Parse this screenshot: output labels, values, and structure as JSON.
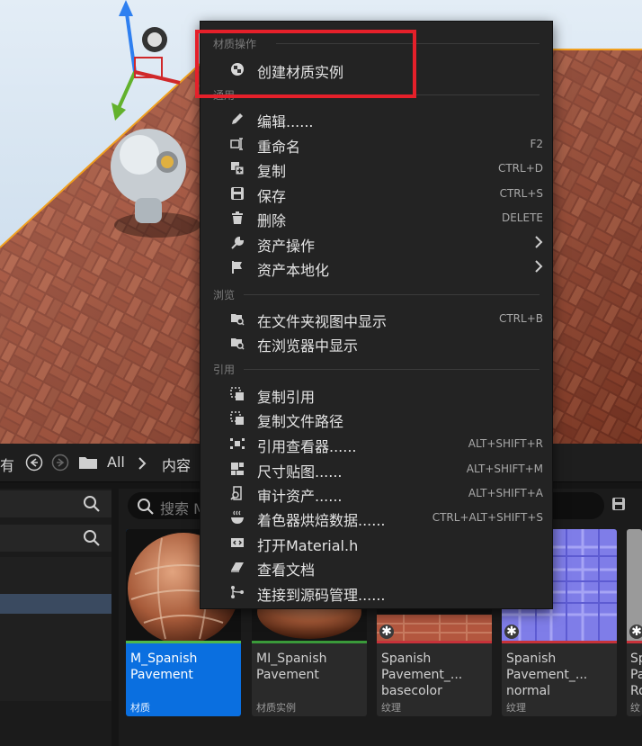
{
  "menu": {
    "section_material": "材质操作",
    "create_instance": "创建材质实例",
    "section_common": "通用",
    "items_common": [
      {
        "label": "编辑......",
        "shortcut": "",
        "icon": "pencil-icon"
      },
      {
        "label": "重命名",
        "shortcut": "F2",
        "icon": "rename-icon"
      },
      {
        "label": "复制",
        "shortcut": "CTRL+D",
        "icon": "duplicate-icon"
      },
      {
        "label": "保存",
        "shortcut": "CTRL+S",
        "icon": "save-icon"
      },
      {
        "label": "删除",
        "shortcut": "DELETE",
        "icon": "trash-icon"
      },
      {
        "label": "资产操作",
        "shortcut": "",
        "icon": "wrench-icon",
        "submenu": true
      },
      {
        "label": "资产本地化",
        "shortcut": "",
        "icon": "flag-icon",
        "submenu": true
      }
    ],
    "section_browse": "浏览",
    "items_browse": [
      {
        "label": "在文件夹视图中显示",
        "shortcut": "CTRL+B",
        "icon": "folder-search-icon"
      },
      {
        "label": "在浏览器中显示",
        "shortcut": "",
        "icon": "folder-search-icon"
      }
    ],
    "section_reference": "引用",
    "items_reference": [
      {
        "label": "复制引用",
        "shortcut": "",
        "icon": "copy-reference-icon"
      },
      {
        "label": "复制文件路径",
        "shortcut": "",
        "icon": "copy-path-icon"
      },
      {
        "label": "引用查看器......",
        "shortcut": "ALT+SHIFT+R",
        "icon": "reference-viewer-icon"
      },
      {
        "label": "尺寸贴图......",
        "shortcut": "ALT+SHIFT+M",
        "icon": "size-map-icon"
      },
      {
        "label": "审计资产......",
        "shortcut": "ALT+SHIFT+A",
        "icon": "audit-icon"
      },
      {
        "label": "着色器烘焙数据......",
        "shortcut": "CTRL+ALT+SHIFT+S",
        "icon": "shader-icon"
      },
      {
        "label": "打开Material.h",
        "shortcut": "",
        "icon": "code-file-icon"
      },
      {
        "label": "查看文档",
        "shortcut": "",
        "icon": "docs-icon"
      },
      {
        "label": "连接到源码管理......",
        "shortcut": "",
        "icon": "source-control-icon"
      }
    ]
  },
  "content_browser": {
    "nav_left_text": "有",
    "path_all": "All",
    "path_content": "内容",
    "search_placeholder": "搜索 M",
    "assets": [
      {
        "name": "M_Spanish\nPavement",
        "type": "材质",
        "selected": true,
        "bar_color": "#4fb84a"
      },
      {
        "name": "MI_Spanish\nPavement",
        "type": "材质实例",
        "selected": false,
        "bar_color": "#3a9a3a"
      },
      {
        "name": "Spanish\nPavement_...\nbasecolor",
        "type": "纹理",
        "selected": false,
        "bar_color": "#c7323a"
      },
      {
        "name": "Spanish\nPavement_...\nnormal",
        "type": "纹理",
        "selected": false,
        "bar_color": "#c7323a"
      },
      {
        "name": "Sp\nPa\nRo",
        "type": "纹",
        "selected": false,
        "bar_color": "#c7323a"
      }
    ]
  },
  "colors": {
    "highlight": "#e5202a",
    "selection": "#0a6fe0",
    "menu_bg": "#232323"
  }
}
